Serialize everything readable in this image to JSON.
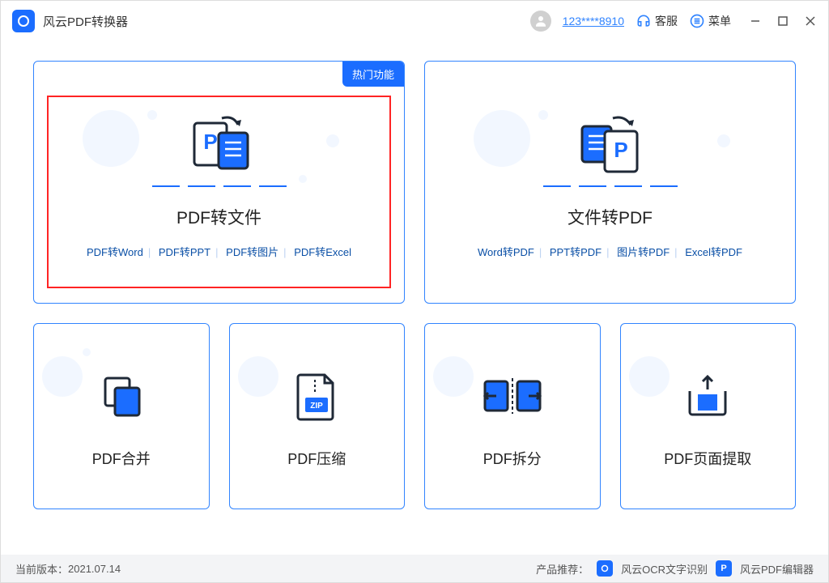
{
  "header": {
    "app_title": "风云PDF转换器",
    "user": "123****8910",
    "support": "客服",
    "menu": "菜单"
  },
  "cards": {
    "big1": {
      "title": "PDF转文件",
      "hot": "热门功能",
      "subs": [
        "PDF转Word",
        "PDF转PPT",
        "PDF转图片",
        "PDF转Excel"
      ]
    },
    "big2": {
      "title": "文件转PDF",
      "subs": [
        "Word转PDF",
        "PPT转PDF",
        "图片转PDF",
        "Excel转PDF"
      ]
    },
    "small": [
      {
        "title": "PDF合并"
      },
      {
        "title": "PDF压缩"
      },
      {
        "title": "PDF拆分"
      },
      {
        "title": "PDF页面提取"
      }
    ]
  },
  "footer": {
    "version_label": "当前版本：",
    "version": "2021.07.14",
    "recommend": "产品推荐：",
    "ocr": "风云OCR文字识别",
    "editor": "风云PDF编辑器"
  }
}
